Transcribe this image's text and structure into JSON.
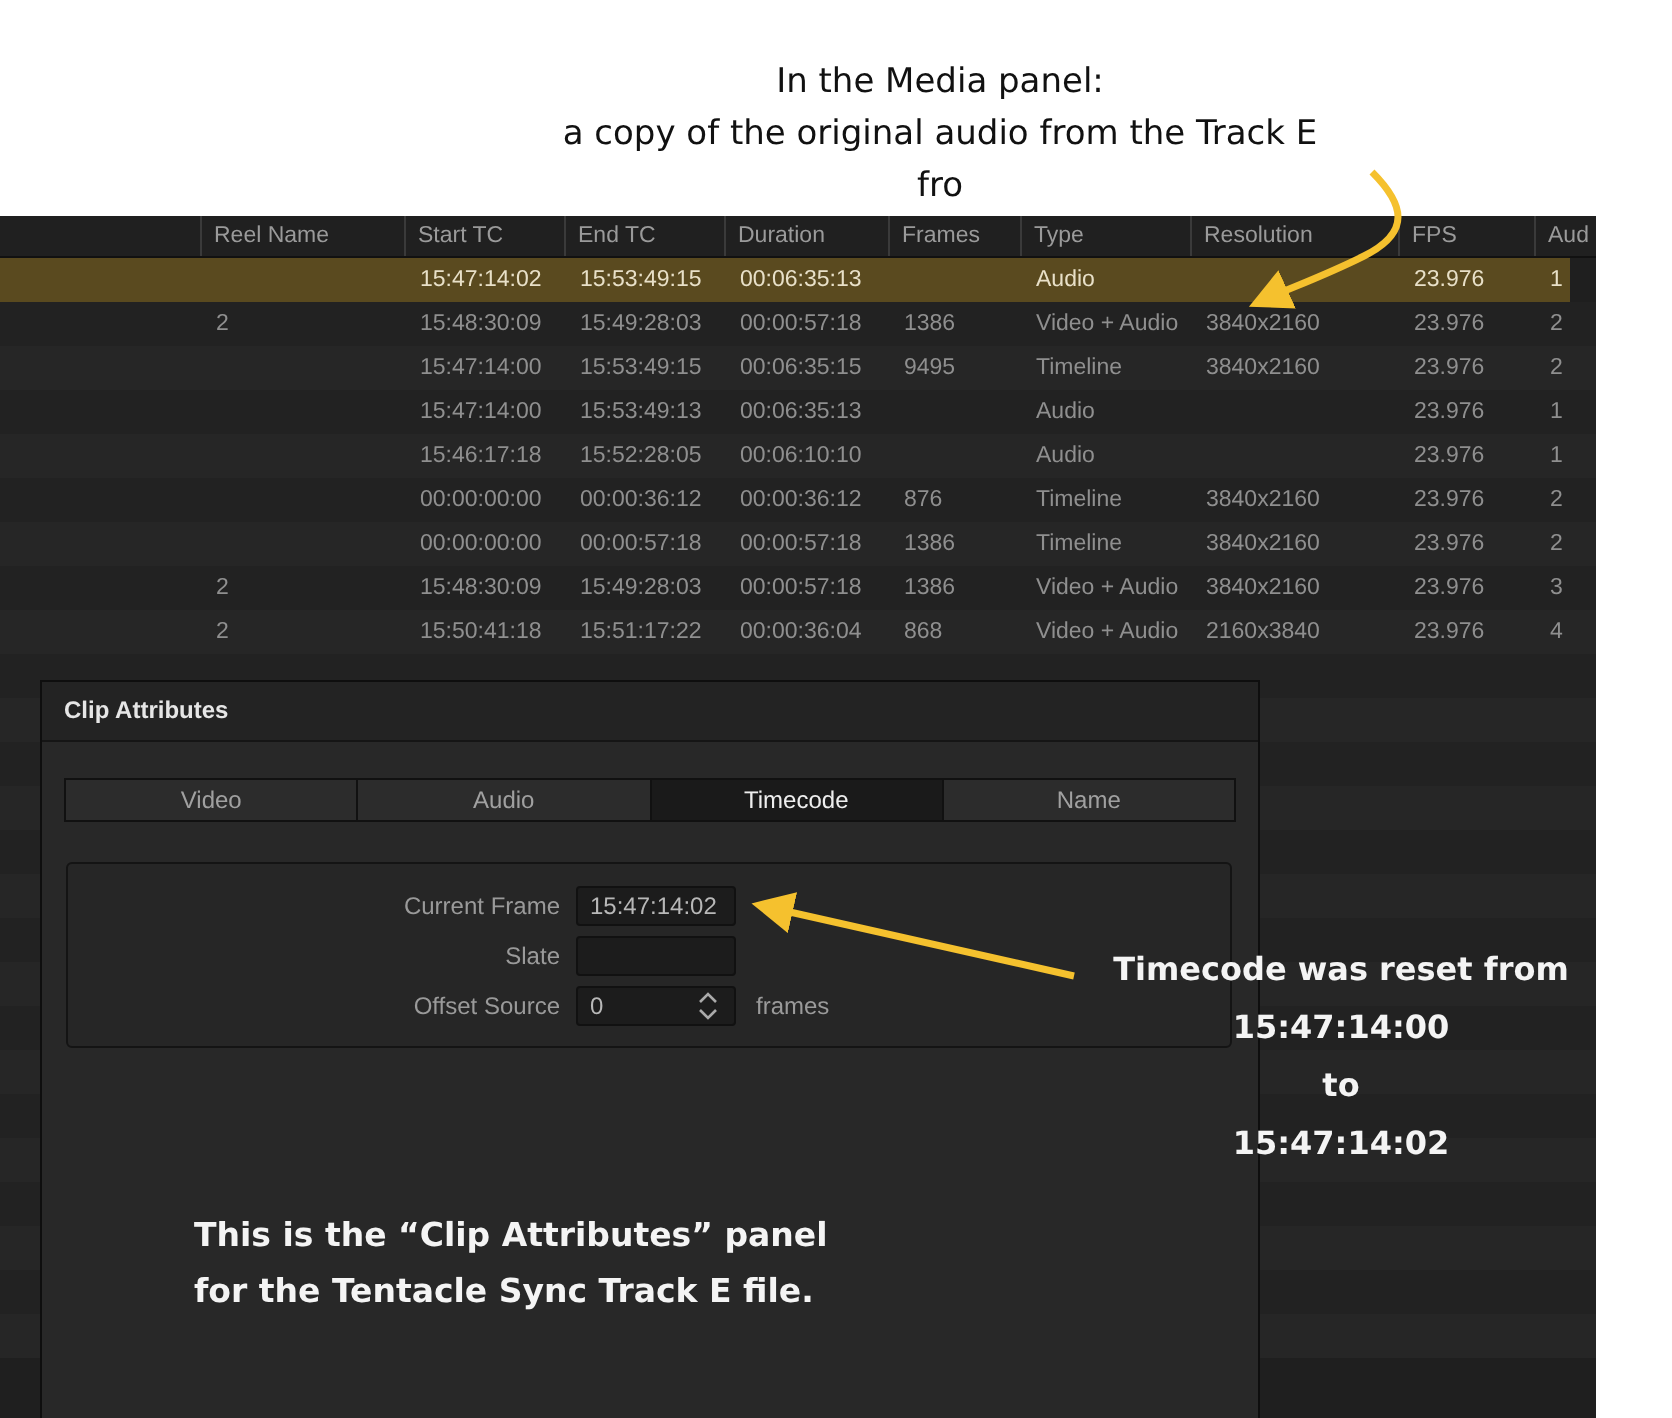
{
  "annotations": {
    "top": [
      "In the Media panel:",
      "a copy of the original audio from the Track E",
      "fro"
    ],
    "right": [
      "Timecode was reset from",
      "15:47:14:00",
      "to",
      "15:47:14:02"
    ],
    "bottom": [
      "This is the “Clip Attributes” panel",
      "for the Tentacle Sync Track E file."
    ]
  },
  "media_table": {
    "columns": [
      "Reel Name",
      "Start TC",
      "End TC",
      "Duration",
      "Frames",
      "Type",
      "Resolution",
      "FPS",
      "Aud"
    ],
    "rows": [
      {
        "selected": true,
        "cells": [
          null,
          "15:47:14:02",
          "15:53:49:15",
          "00:06:35:13",
          null,
          "Audio",
          null,
          "23.976",
          "1"
        ]
      },
      {
        "selected": false,
        "cells": [
          "2",
          "15:48:30:09",
          "15:49:28:03",
          "00:00:57:18",
          "1386",
          "Video + Audio",
          "3840x2160",
          "23.976",
          "2"
        ]
      },
      {
        "selected": false,
        "cells": [
          null,
          "15:47:14:00",
          "15:53:49:15",
          "00:06:35:15",
          "9495",
          "Timeline",
          "3840x2160",
          "23.976",
          "2"
        ]
      },
      {
        "selected": false,
        "cells": [
          null,
          "15:47:14:00",
          "15:53:49:13",
          "00:06:35:13",
          null,
          "Audio",
          null,
          "23.976",
          "1"
        ]
      },
      {
        "selected": false,
        "cells": [
          null,
          "15:46:17:18",
          "15:52:28:05",
          "00:06:10:10",
          null,
          "Audio",
          null,
          "23.976",
          "1"
        ]
      },
      {
        "selected": false,
        "cells": [
          null,
          "00:00:00:00",
          "00:00:36:12",
          "00:00:36:12",
          "876",
          "Timeline",
          "3840x2160",
          "23.976",
          "2"
        ]
      },
      {
        "selected": false,
        "cells": [
          null,
          "00:00:00:00",
          "00:00:57:18",
          "00:00:57:18",
          "1386",
          "Timeline",
          "3840x2160",
          "23.976",
          "2"
        ]
      },
      {
        "selected": false,
        "cells": [
          "2",
          "15:48:30:09",
          "15:49:28:03",
          "00:00:57:18",
          "1386",
          "Video + Audio",
          "3840x2160",
          "23.976",
          "3"
        ]
      },
      {
        "selected": false,
        "cells": [
          "2",
          "15:50:41:18",
          "15:51:17:22",
          "00:00:36:04",
          "868",
          "Video + Audio",
          "2160x3840",
          "23.976",
          "4"
        ]
      }
    ]
  },
  "clip_attributes": {
    "title": "Clip Attributes",
    "tabs": [
      {
        "label": "Video",
        "selected": false
      },
      {
        "label": "Audio",
        "selected": false
      },
      {
        "label": "Timecode",
        "selected": true
      },
      {
        "label": "Name",
        "selected": false
      }
    ],
    "fields": [
      {
        "kind": "text",
        "label": "Current Frame",
        "value": "15:47:14:02"
      },
      {
        "kind": "text",
        "label": "Slate"
      },
      {
        "kind": "spinner",
        "label": "Offset Source",
        "value": "0",
        "unit": "frames"
      }
    ]
  }
}
